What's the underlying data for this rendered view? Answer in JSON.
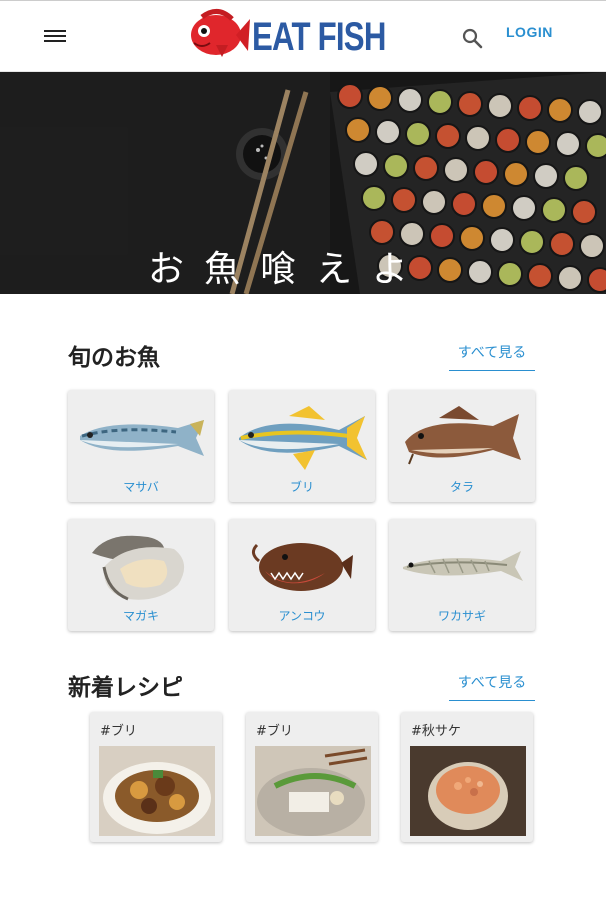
{
  "header": {
    "logo_text": "EAT FISH",
    "login_label": "LOGIN"
  },
  "hero": {
    "title": "お魚喰えよ"
  },
  "seasonal": {
    "title": "旬のお魚",
    "see_all": "すべて見る",
    "fish": [
      {
        "name": "マサバ",
        "icon": "mackerel-icon"
      },
      {
        "name": "ブリ",
        "icon": "yellowtail-icon"
      },
      {
        "name": "タラ",
        "icon": "cod-icon"
      },
      {
        "name": "マガキ",
        "icon": "oyster-icon"
      },
      {
        "name": "アンコウ",
        "icon": "anglerfish-icon"
      },
      {
        "name": "ワカサギ",
        "icon": "smelt-icon"
      }
    ]
  },
  "recipes": {
    "title": "新着レシピ",
    "see_all": "すべて見る",
    "items": [
      {
        "tag": "#ブリ"
      },
      {
        "tag": "#ブリ"
      },
      {
        "tag": "#秋サケ"
      }
    ]
  }
}
